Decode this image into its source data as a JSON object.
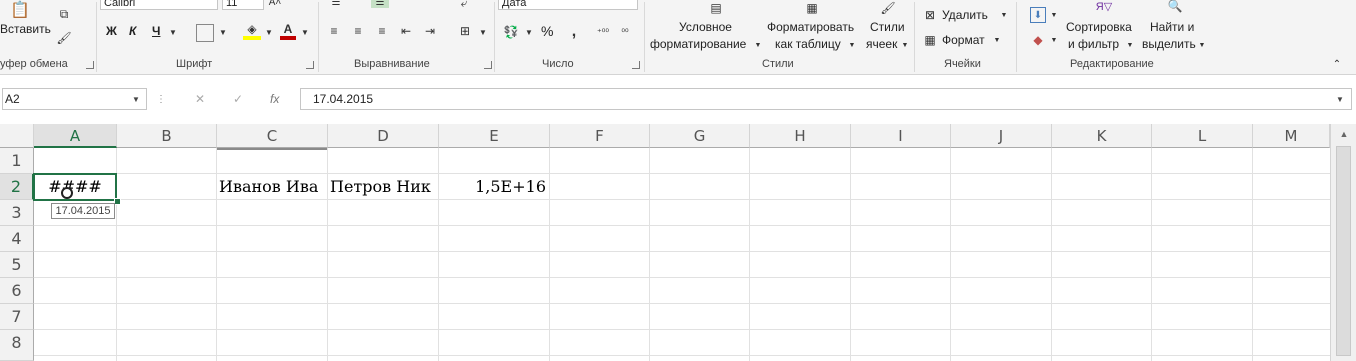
{
  "ribbon": {
    "clipboard": {
      "paste_label": "Вставить",
      "group_label": "уфер обмена"
    },
    "font": {
      "font_name": "Calibri",
      "font_size": "11",
      "bold_label": "Ж",
      "italic_label": "К",
      "underline_label": "Ч",
      "group_label": "Шрифт"
    },
    "alignment": {
      "group_label": "Выравнивание"
    },
    "number": {
      "format_value": "Дата",
      "percent_label": "%",
      "group_label": "Число"
    },
    "styles": {
      "conditional_line1": "Условное",
      "conditional_line2": "форматирование",
      "format_table_line1": "Форматировать",
      "format_table_line2": "как таблицу",
      "cell_styles_line1": "Стили",
      "cell_styles_line2": "ячеек",
      "group_label": "Стили"
    },
    "cells": {
      "delete_label": "Удалить",
      "format_label": "Формат",
      "group_label": "Ячейки"
    },
    "editing": {
      "sort_line1": "Сортировка",
      "sort_line2": "и фильтр",
      "find_line1": "Найти и",
      "find_line2": "выделить",
      "group_label": "Редактирование"
    }
  },
  "formula_bar": {
    "name_box": "A2",
    "fx_label": "fx",
    "formula_value": "17.04.2015"
  },
  "columns": [
    "A",
    "B",
    "C",
    "D",
    "E",
    "F",
    "G",
    "H",
    "I",
    "J",
    "K",
    "L",
    "M"
  ],
  "rows": [
    "1",
    "2",
    "3",
    "4",
    "5",
    "6",
    "7",
    "8"
  ],
  "cells": {
    "A2": "####",
    "C2": "Иванов Ива",
    "D2": "Петров Ник",
    "E2": "1,5E+16"
  },
  "tooltip": "17.04.2015",
  "colors": {
    "accent": "#217346",
    "header_bg": "#f2f2f2",
    "grid": "#e1e1e1",
    "font_red": "#c00000",
    "fill_yellow": "#ffff00"
  }
}
